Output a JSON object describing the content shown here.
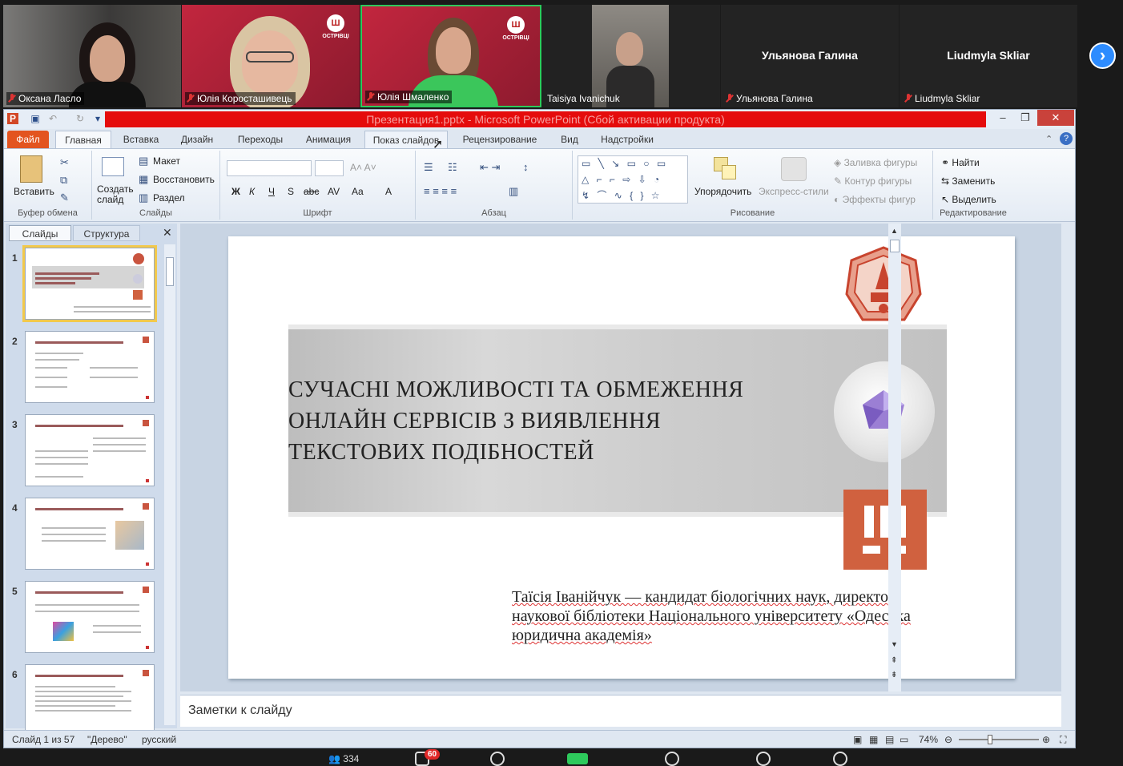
{
  "zoom": {
    "participants": [
      {
        "name": "Оксана Ласло",
        "muted": true
      },
      {
        "name": "Юлія Коросташивець",
        "muted": true
      },
      {
        "name": "Юлія Шмаленко",
        "muted": true,
        "active_speaker": true
      },
      {
        "name": "Taisiya Ivanichuk",
        "muted": false
      },
      {
        "name": "Ульянова Галина",
        "muted": true,
        "video": false
      },
      {
        "name": "Liudmyla Skliar",
        "muted": true,
        "video": false
      }
    ],
    "brand_text": "ОСТРІВЦІ",
    "participants_count": "334",
    "chat_badge": "60",
    "next_page_icon": "chevron-right-icon"
  },
  "ppt": {
    "window_title": "Презентация1.pptx - Microsoft PowerPoint (Сбой активации продукта)",
    "tabs": [
      "Файл",
      "Главная",
      "Вставка",
      "Дизайн",
      "Переходы",
      "Анимация",
      "Показ слайдов",
      "Рецензирование",
      "Вид",
      "Надстройки"
    ],
    "ribbon": {
      "clipboard": {
        "paste": "Вставить",
        "label": "Буфер обмена"
      },
      "slides": {
        "new_slide": "Создать слайд",
        "layout": "Макет",
        "reset": "Восстановить",
        "section": "Раздел",
        "label": "Слайды"
      },
      "font": {
        "label": "Шрифт",
        "bold": "Ж",
        "italic": "К",
        "underline": "Ч",
        "shadow": "S",
        "strike": "abc",
        "spacing": "AV",
        "case": "Aa",
        "color": "A"
      },
      "paragraph": {
        "label": "Абзац"
      },
      "drawing": {
        "arrange": "Упорядочить",
        "quick_styles": "Экспресс-стили",
        "fill": "Заливка фигуры",
        "outline": "Контур фигуры",
        "effects": "Эффекты фигур",
        "label": "Рисование"
      },
      "editing": {
        "find": "Найти",
        "replace": "Заменить",
        "select": "Выделить",
        "label": "Редактирование"
      }
    },
    "pane_tabs": {
      "slides": "Слайды",
      "outline": "Структура"
    },
    "thumbnails": [
      "1",
      "2",
      "3",
      "4",
      "5",
      "6"
    ],
    "slide": {
      "title_lines": [
        "СУЧАСНІ МОЖЛИВОСТІ ТА ОБМЕЖЕННЯ",
        "ОНЛАЙН СЕРВІСІВ З ВИЯВЛЕННЯ",
        "ТЕКСТОВИХ ПОДІБНОСТЕЙ"
      ],
      "author_lines": [
        "Таїсія Іванійчук — кандидат біологічних наук, директор",
        "наукової бібліотеки Національного університету «Одеська",
        "юридична академія»"
      ],
      "logo_mark": "!!!",
      "colors": {
        "logo_orange": "#d0613f",
        "seal_red": "#c8442e"
      }
    },
    "notes_placeholder": "Заметки к слайду",
    "status": {
      "slide": "Слайд 1 из 57",
      "theme": "\"Дерево\"",
      "language": "русский",
      "zoom": "74%"
    }
  }
}
